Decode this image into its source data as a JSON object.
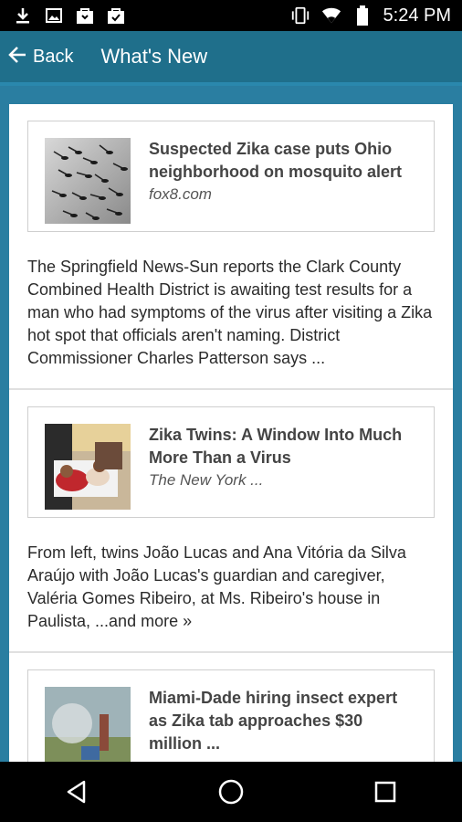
{
  "status_bar": {
    "time": "5:24 PM",
    "left_icons": [
      "download-icon",
      "image-icon",
      "bag-icon",
      "bag-check-icon"
    ],
    "right_icons": [
      "vibrate-icon",
      "wifi-icon",
      "battery-icon"
    ]
  },
  "app_bar": {
    "back_label": "Back",
    "title": "What's New"
  },
  "articles": [
    {
      "headline": "Suspected Zika case puts Ohio neighborhood on mosquito alert",
      "source": "fox8.com",
      "summary": "The Springfield News-Sun reports the Clark County Combined Health District is awaiting test results for a man who had symptoms of the virus after visiting a Zika hot spot that officials aren't naming. District Commissioner Charles Patterson says ..."
    },
    {
      "headline": "Zika Twins: A Window Into Much More Than a Virus",
      "source": "The New York ...",
      "summary": "From left, twins João Lucas and Ana Vitória da Silva Araújo with João Lucas's guardian and caregiver, Valéria Gomes Ribeiro, at Ms. Ribeiro's house in Paulista, ...and more »"
    },
    {
      "headline": "Miami-Dade hiring insect expert as Zika tab approaches $30 million ...",
      "source": "",
      "summary": ""
    }
  ],
  "colors": {
    "app_bar": "#1f6f8b",
    "background": "#2a7ea1"
  }
}
